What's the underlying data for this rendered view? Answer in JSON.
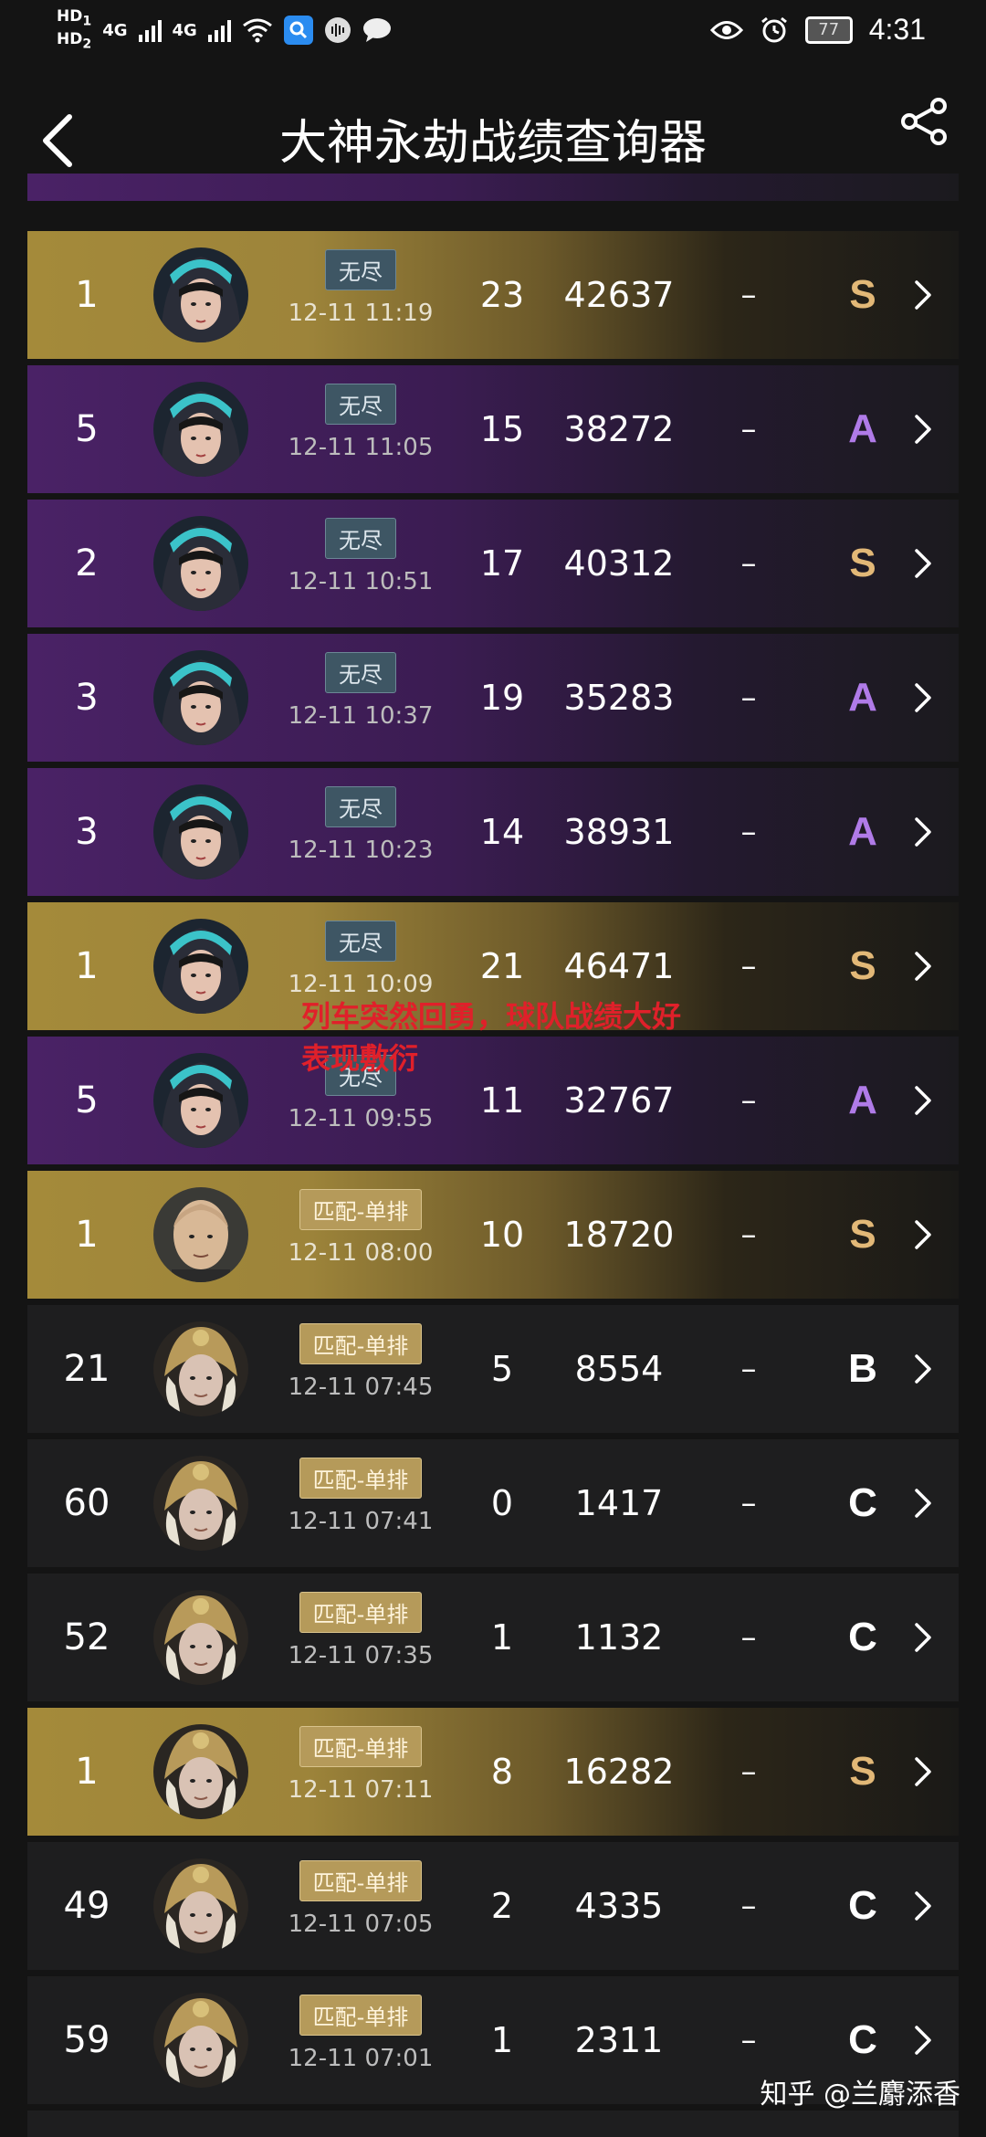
{
  "status_bar": {
    "hd_top": "HD",
    "hd_top_sub": "1",
    "hd_bottom": "HD",
    "hd_bottom_sub": "2",
    "network_1": "4G",
    "network_2": "4G",
    "battery": "77",
    "time": "4:31"
  },
  "header": {
    "title": "大神永劫战绩查询器"
  },
  "rows": [
    {
      "rank": "1",
      "avatar": "female-hooded",
      "mode": "无尽",
      "mode_type": "endless",
      "time": "12-11 11:19",
      "kills": "23",
      "score": "42637",
      "extra": "–",
      "grade": "S",
      "style": "gold"
    },
    {
      "rank": "5",
      "avatar": "female-hooded",
      "mode": "无尽",
      "mode_type": "endless",
      "time": "12-11 11:05",
      "kills": "15",
      "score": "38272",
      "extra": "–",
      "grade": "A",
      "style": "purple"
    },
    {
      "rank": "2",
      "avatar": "female-hooded",
      "mode": "无尽",
      "mode_type": "endless",
      "time": "12-11 10:51",
      "kills": "17",
      "score": "40312",
      "extra": "–",
      "grade": "S",
      "style": "purple"
    },
    {
      "rank": "3",
      "avatar": "female-hooded",
      "mode": "无尽",
      "mode_type": "endless",
      "time": "12-11 10:37",
      "kills": "19",
      "score": "35283",
      "extra": "–",
      "grade": "A",
      "style": "purple"
    },
    {
      "rank": "3",
      "avatar": "female-hooded",
      "mode": "无尽",
      "mode_type": "endless",
      "time": "12-11 10:23",
      "kills": "14",
      "score": "38931",
      "extra": "–",
      "grade": "A",
      "style": "purple"
    },
    {
      "rank": "1",
      "avatar": "female-hooded",
      "mode": "无尽",
      "mode_type": "endless",
      "time": "12-11 10:09",
      "kills": "21",
      "score": "46471",
      "extra": "–",
      "grade": "S",
      "style": "gold"
    },
    {
      "rank": "5",
      "avatar": "female-hooded",
      "mode": "无尽",
      "mode_type": "endless",
      "time": "12-11 09:55",
      "kills": "11",
      "score": "32767",
      "extra": "–",
      "grade": "A",
      "style": "purple"
    },
    {
      "rank": "1",
      "avatar": "male-bald",
      "mode": "匹配-单排",
      "mode_type": "match",
      "time": "12-11 08:00",
      "kills": "10",
      "score": "18720",
      "extra": "–",
      "grade": "S",
      "style": "gold"
    },
    {
      "rank": "21",
      "avatar": "male-helmet",
      "mode": "匹配-单排",
      "mode_type": "match",
      "time": "12-11 07:45",
      "kills": "5",
      "score": "8554",
      "extra": "–",
      "grade": "B",
      "style": "dark"
    },
    {
      "rank": "60",
      "avatar": "male-helmet",
      "mode": "匹配-单排",
      "mode_type": "match",
      "time": "12-11 07:41",
      "kills": "0",
      "score": "1417",
      "extra": "–",
      "grade": "C",
      "style": "dark"
    },
    {
      "rank": "52",
      "avatar": "male-helmet",
      "mode": "匹配-单排",
      "mode_type": "match",
      "time": "12-11 07:35",
      "kills": "1",
      "score": "1132",
      "extra": "–",
      "grade": "C",
      "style": "dark"
    },
    {
      "rank": "1",
      "avatar": "male-helmet",
      "mode": "匹配-单排",
      "mode_type": "match",
      "time": "12-11 07:11",
      "kills": "8",
      "score": "16282",
      "extra": "–",
      "grade": "S",
      "style": "gold"
    },
    {
      "rank": "49",
      "avatar": "male-helmet",
      "mode": "匹配-单排",
      "mode_type": "match",
      "time": "12-11 07:05",
      "kills": "2",
      "score": "4335",
      "extra": "–",
      "grade": "C",
      "style": "dark"
    },
    {
      "rank": "59",
      "avatar": "male-helmet",
      "mode": "匹配-单排",
      "mode_type": "match",
      "time": "12-11 07:01",
      "kills": "1",
      "score": "2311",
      "extra": "–",
      "grade": "C",
      "style": "dark"
    }
  ],
  "grade_colors": {
    "S": "#e2b877",
    "A": "#b07be8",
    "B": "#ffffff",
    "C": "#ffffff"
  },
  "overlay_text": "列车突然回勇，球队战绩大好表现敷衍",
  "watermark": "知乎 @兰麝添香"
}
